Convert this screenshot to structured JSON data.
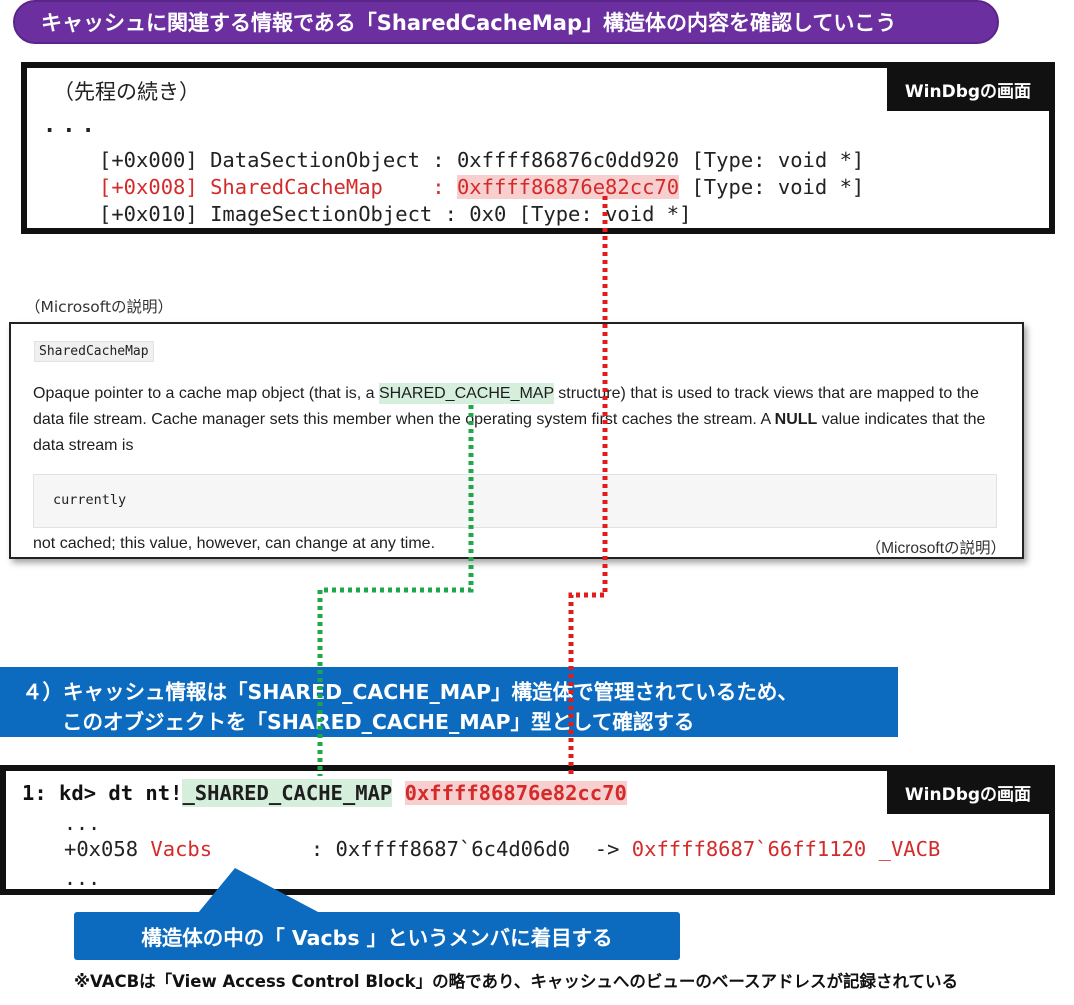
{
  "title": "キャッシュに関連する情報である「SharedCacheMap」構造体の内容を確認していこう",
  "top_panel": {
    "tag": "WinDbgの画面",
    "continuation_note": "（先程の続き）",
    "dots": "...",
    "lines": [
      {
        "offset": "[+0x000]",
        "name": "DataSectionObject",
        "sep": " : ",
        "value": "0xffff86876c0dd920",
        "type": " [Type: void *]"
      },
      {
        "offset": "[+0x008]",
        "name": "SharedCacheMap   ",
        "sep": " : ",
        "value": "0xffff86876e82cc70",
        "type": " [Type: void *]"
      },
      {
        "offset": "[+0x010]",
        "name": "ImageSectionObject",
        "sep": " : ",
        "value": "0x0",
        "type": " [Type: void *]"
      }
    ]
  },
  "ms_doc": {
    "label_top": "（Microsoftの説明）",
    "chip": "SharedCacheMap",
    "para_1": "Opaque pointer to a cache map object (that is, a ",
    "para_highlight": "SHARED_CACHE_MAP",
    "para_2": " structure) that is used to track views that are mapped to the data file stream. Cache manager sets this member when the operating system first caches the stream. A ",
    "para_bold": "NULL",
    "para_3": " value indicates that the data stream is",
    "code_box": "currently",
    "tail": "not cached; this value, however, can change at any time.",
    "label_bottom": "（Microsoftの説明）"
  },
  "step": {
    "line_1": "４）キャッシュ情報は「SHARED_CACHE_MAP」構造体で管理されているため、",
    "line_2": "このオブジェクトを「SHARED_CACHE_MAP」型として確認する"
  },
  "bottom_panel": {
    "tag": "WinDbgの画面",
    "prompt": "1: kd> dt nt!",
    "struct": "_SHARED_CACHE_MAP",
    "address": "0xffff86876e82cc70",
    "dots": "...",
    "field_offset": "+0x058 ",
    "field_name": "Vacbs",
    "field_sep": "        : ",
    "field_value": "0xffff8687`6c4d06d0",
    "field_arrow": "  -> ",
    "field_target": "0xffff8687`66ff1120 _VACB"
  },
  "callout": "構造体の中の「 Vacbs 」というメンバに着目する",
  "footnote": "※VACBは「View Access Control Block」の略であり、キャッシュへのビューのベースアドレスが記録されている",
  "colors": {
    "title_bg": "#6b2fa0",
    "banner_bg": "#0d6bbf",
    "highlight_red": "#d42a2a",
    "highlight_green": "#d5efdc",
    "connector_red": "#e01c1c",
    "connector_green": "#1fa84a"
  }
}
